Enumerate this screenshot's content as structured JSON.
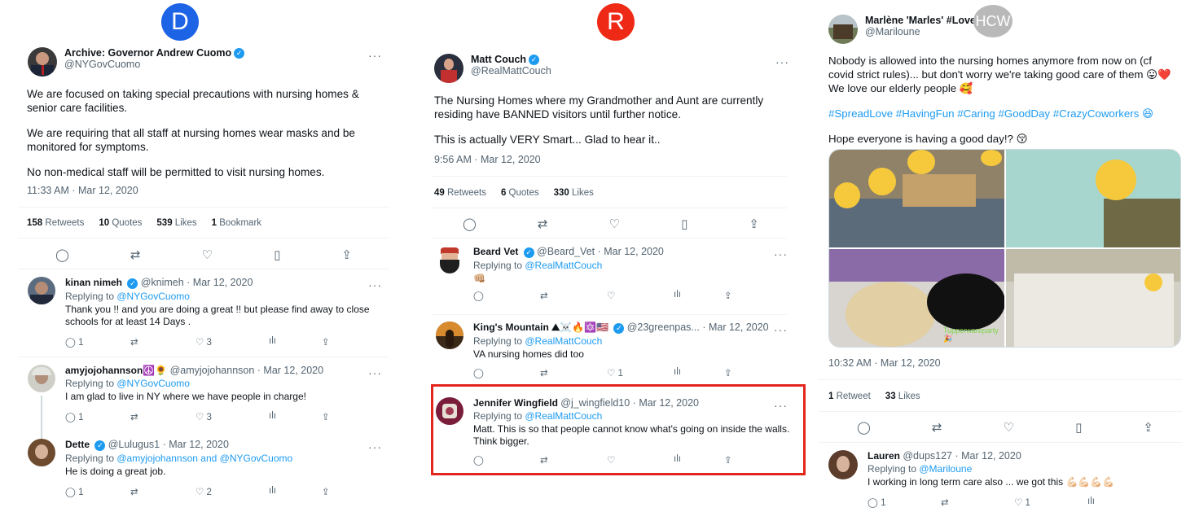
{
  "labels": {
    "d": "D",
    "r": "R",
    "h": "HCW"
  },
  "left": {
    "author_name": "Archive: Governor Andrew Cuomo",
    "author_handle": "@NYGovCuomo",
    "paragraphs": [
      "We are focused on taking special precautions with nursing homes & senior care facilities.",
      "We are requiring that all staff at nursing homes wear masks and be monitored for symptoms.",
      "No non-medical staff will be permitted to visit nursing homes."
    ],
    "timestamp": "11:33 AM · Mar 12, 2020",
    "stats": [
      {
        "num": "158",
        "label": "Retweets"
      },
      {
        "num": "10",
        "label": "Quotes"
      },
      {
        "num": "539",
        "label": "Likes"
      },
      {
        "num": "1",
        "label": "Bookmark"
      }
    ],
    "replies": [
      {
        "name": "kinan nimeh",
        "handle": "@knimeh · Mar 12, 2020",
        "replying_prefix": "Replying to ",
        "replying_to": "@NYGovCuomo",
        "text": "Thank you !! and you are doing a great !! but please find away  to close schools for at least 14 Days .",
        "replies_count": "1",
        "likes_count": "3"
      },
      {
        "name": "amyjojohannson☮️🌻",
        "handle": "@amyjojohannson · Mar 12, 2020",
        "replying_prefix": "Replying to ",
        "replying_to": "@NYGovCuomo",
        "text": "I am glad to live in NY where we have people in charge!",
        "replies_count": "1",
        "likes_count": "3"
      },
      {
        "name": "Dette",
        "handle": "@Lulugus1 · Mar 12, 2020",
        "replying_prefix": "Replying to ",
        "replying_to": "@amyjojohannson and @NYGovCuomo",
        "text": "He is doing a great job.",
        "replies_count": "1",
        "likes_count": "2"
      }
    ]
  },
  "middle": {
    "author_name": "Matt Couch",
    "author_handle": "@RealMattCouch",
    "paragraphs": [
      "The Nursing Homes where my Grandmother and Aunt are currently residing have BANNED visitors until further notice.",
      "This is actually VERY Smart... Glad to hear it.."
    ],
    "timestamp": "9:56 AM · Mar 12, 2020",
    "stats": [
      {
        "num": "49",
        "label": "Retweets"
      },
      {
        "num": "6",
        "label": "Quotes"
      },
      {
        "num": "330",
        "label": "Likes"
      }
    ],
    "replies": [
      {
        "name": "Beard Vet",
        "handle": "@Beard_Vet · Mar 12, 2020",
        "replying_prefix": "Replying to ",
        "replying_to": "@RealMattCouch",
        "text": "👊🏼",
        "likes_count": ""
      },
      {
        "name": "King's Mountain ⛰☠️🔥🔯🇺🇸",
        "handle": "@23greenpas... · Mar 12, 2020",
        "replying_prefix": "Replying to ",
        "replying_to": "@RealMattCouch",
        "text": "VA nursing homes did too",
        "likes_count": "1"
      },
      {
        "name": "Jennifer Wingfield",
        "handle": "@j_wingfield10 · Mar 12, 2020",
        "replying_prefix": "Replying to ",
        "replying_to": "@RealMattCouch",
        "text": "Matt. This is so that people cannot know what's going on inside the walls. Think bigger.",
        "likes_count": ""
      }
    ]
  },
  "right": {
    "author_name": "Marlène 'Marles' #LoveM",
    "author_handle": "@Mariloune",
    "paragraphs": [
      "Nobody is allowed into the nursing homes anymore from now on (cf covid strict rules)... but don't worry we're taking good care of them 😛❤️ We love our elderly people 🥰",
      "#SpreadLove #HavingFun #Caring #GoodDay #CrazyCoworkers 😆",
      "Hope everyone is having a good day!? 😚"
    ],
    "timestamp": "10:32 AM · Mar 12, 2020",
    "stats": [
      {
        "num": "1",
        "label": "Retweet"
      },
      {
        "num": "33",
        "label": "Likes"
      }
    ],
    "photo_caption": "Tupperwareparty 🎉",
    "replies": [
      {
        "name": "Lauren",
        "handle": "@dups127 · Mar 12, 2020",
        "replying_prefix": "Replying to ",
        "replying_to": "@Mariloune",
        "text": "I working in long term care also ... we got this 💪🏻💪🏻💪🏻💪🏻",
        "replies_count": "1",
        "likes_count": "1"
      }
    ]
  },
  "icons": {
    "more": "···",
    "reply": "◯",
    "retweet": "⇄",
    "like": "♡",
    "bookmark": "🔖",
    "share": "⇪",
    "views": "ılı",
    "verified": "✓"
  },
  "colors": {
    "blue_badge": "#1d63e6",
    "red_badge": "#ee2a16",
    "highlight": "#e3261c",
    "link": "#1d9bf0"
  }
}
